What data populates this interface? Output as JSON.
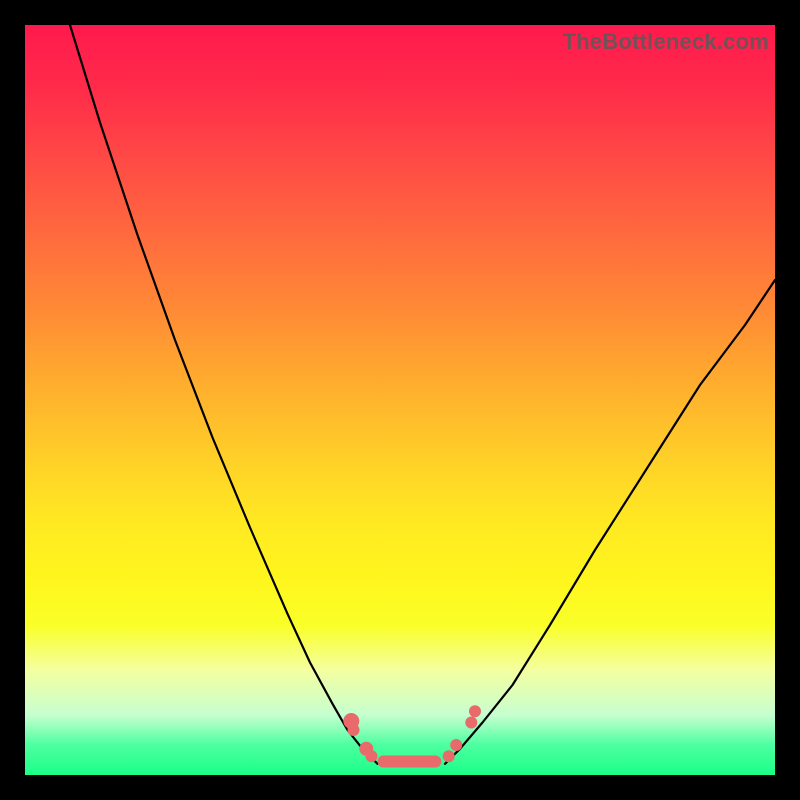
{
  "watermark": "TheBottleneck.com",
  "chart_data": {
    "type": "line",
    "title": "",
    "xlabel": "",
    "ylabel": "",
    "xlim": [
      0,
      1
    ],
    "ylim": [
      0,
      1
    ],
    "series": [
      {
        "name": "left-curve",
        "x": [
          0.06,
          0.1,
          0.15,
          0.2,
          0.25,
          0.3,
          0.35,
          0.38,
          0.41,
          0.43,
          0.45,
          0.47
        ],
        "y": [
          1.0,
          0.87,
          0.72,
          0.58,
          0.45,
          0.33,
          0.215,
          0.15,
          0.095,
          0.06,
          0.035,
          0.015
        ]
      },
      {
        "name": "right-curve",
        "x": [
          0.56,
          0.58,
          0.61,
          0.65,
          0.7,
          0.76,
          0.83,
          0.9,
          0.96,
          1.0
        ],
        "y": [
          0.015,
          0.035,
          0.07,
          0.12,
          0.2,
          0.3,
          0.41,
          0.52,
          0.6,
          0.66
        ]
      }
    ],
    "markers": {
      "name": "valley-dots",
      "points": [
        {
          "x": 0.435,
          "y": 0.072,
          "r": 8
        },
        {
          "x": 0.438,
          "y": 0.06,
          "r": 6
        },
        {
          "x": 0.455,
          "y": 0.035,
          "r": 7
        },
        {
          "x": 0.462,
          "y": 0.025,
          "r": 6
        },
        {
          "x": 0.565,
          "y": 0.025,
          "r": 6
        },
        {
          "x": 0.575,
          "y": 0.04,
          "r": 6
        },
        {
          "x": 0.595,
          "y": 0.07,
          "r": 6
        },
        {
          "x": 0.6,
          "y": 0.085,
          "r": 6
        }
      ],
      "bar": {
        "x0": 0.47,
        "x1": 0.555,
        "y": 0.01,
        "h": 0.016
      }
    },
    "background_gradient": {
      "top": "#ff1a4d",
      "mid": "#ffd028",
      "bottom": "#1aff88"
    }
  }
}
